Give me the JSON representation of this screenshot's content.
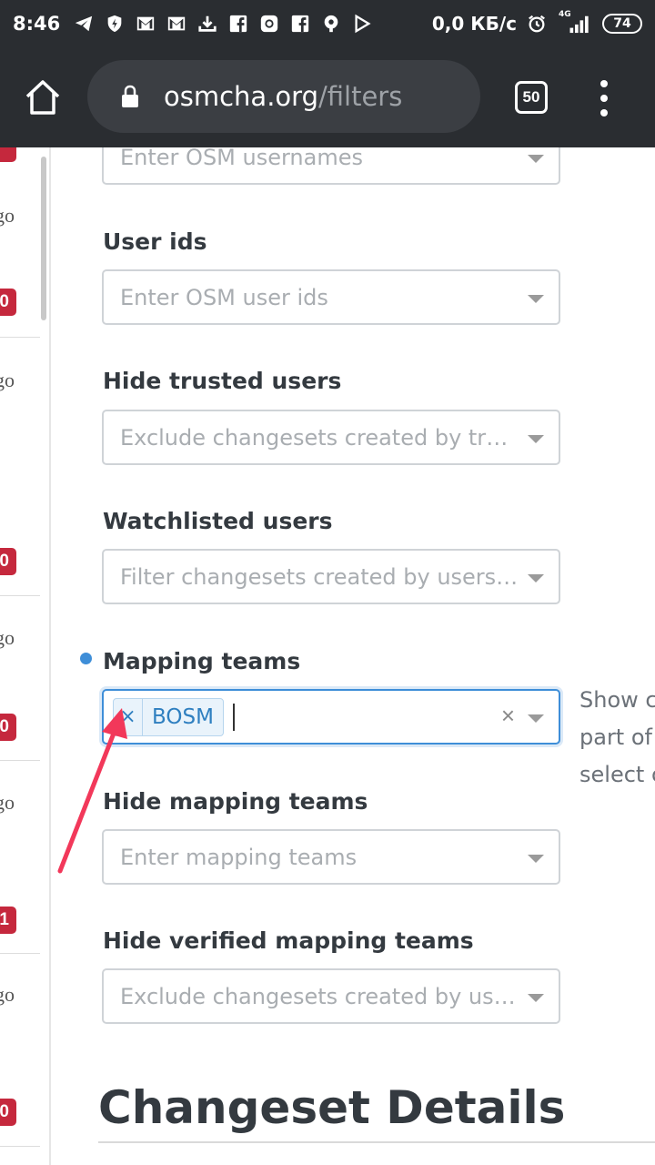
{
  "status_bar": {
    "time": "8:46",
    "net_speed": "0,0 КБ/с",
    "network_type": "4G",
    "battery": "74",
    "icons": [
      "telegram-icon",
      "shield-bolt-icon",
      "gmail-icon",
      "gmail-icon",
      "download-icon",
      "facebook-icon",
      "instagram-icon",
      "facebook-icon",
      "podcast-icon",
      "play-icon"
    ]
  },
  "browser": {
    "url_host": "osmcha.org",
    "url_path": "/filters",
    "tab_count": "50"
  },
  "left_list": {
    "items": [
      {
        "ago": "go",
        "badge": "0"
      },
      {
        "ago": "go",
        "badge": "0"
      },
      {
        "ago": "go",
        "badge": "0"
      },
      {
        "ago": "go",
        "badge": "1"
      },
      {
        "ago": "go",
        "badge": "0"
      }
    ]
  },
  "filters": {
    "users_placeholder": "Enter OSM usernames",
    "user_ids": {
      "label": "User ids",
      "placeholder": "Enter OSM user ids"
    },
    "hide_trusted": {
      "label": "Hide trusted users",
      "placeholder": "Exclude changesets created by truste…"
    },
    "watchlisted": {
      "label": "Watchlisted users",
      "placeholder": "Filter changesets created by users fro…"
    },
    "mapping_teams": {
      "label": "Mapping teams",
      "chip_remove": "×",
      "chip_label": "BOSM",
      "clear": "×",
      "help_lines": [
        "Show c",
        "part of",
        "select c"
      ]
    },
    "hide_mapping_teams": {
      "label": "Hide mapping teams",
      "placeholder": "Enter mapping teams"
    },
    "hide_verified": {
      "label": "Hide verified mapping teams",
      "placeholder": "Exclude changesets created by users …"
    }
  },
  "section": {
    "title": "Changeset Details"
  },
  "colors": {
    "accent": "#3e8ed8",
    "badge": "#c5283d",
    "annotation_arrow": "#f2385a"
  }
}
